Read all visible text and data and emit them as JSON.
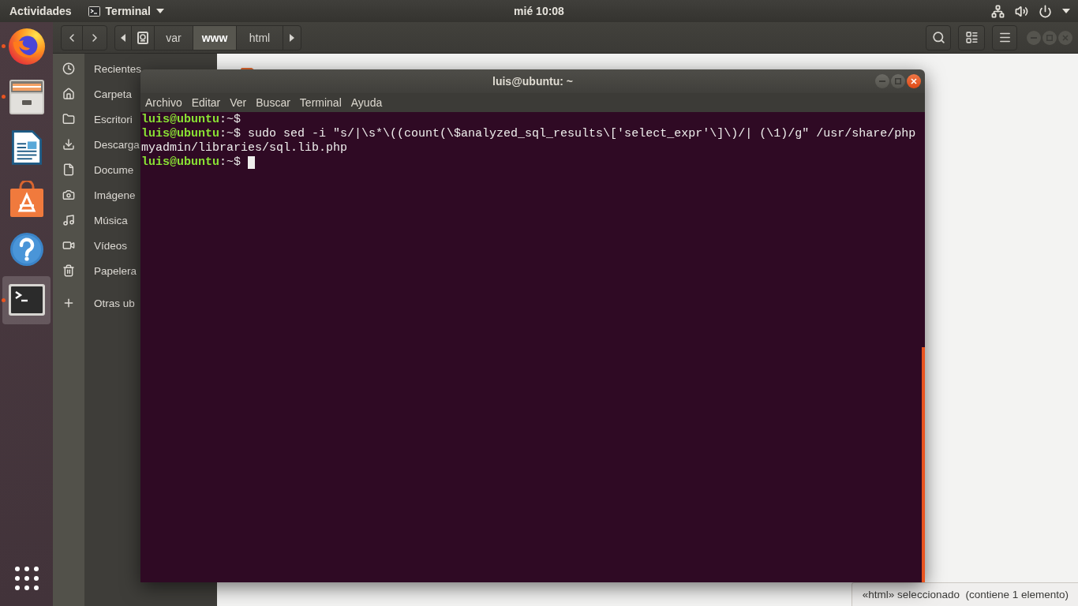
{
  "top_bar": {
    "activities": "Actividades",
    "app_menu": "Terminal",
    "clock": "mié 10:08"
  },
  "dock": {
    "items": [
      {
        "kind": "browser",
        "running": true,
        "selected": false
      },
      {
        "kind": "files",
        "running": true,
        "selected": false
      },
      {
        "kind": "writer",
        "running": false,
        "selected": false
      },
      {
        "kind": "software",
        "running": false,
        "selected": false
      },
      {
        "kind": "help",
        "running": false,
        "selected": false
      },
      {
        "kind": "terminal",
        "running": true,
        "selected": true
      }
    ]
  },
  "files_window": {
    "path_bar": [
      {
        "label": "var",
        "selected": false
      },
      {
        "label": "www",
        "selected": true
      },
      {
        "label": "html",
        "selected": false
      }
    ],
    "sidebar": {
      "items": [
        {
          "kind": "recent",
          "label": "Recientes"
        },
        {
          "kind": "home",
          "label": "Carpeta"
        },
        {
          "kind": "desktop",
          "label": "Escritori"
        },
        {
          "kind": "downloads",
          "label": "Descarga"
        },
        {
          "kind": "documents",
          "label": "Docume"
        },
        {
          "kind": "pictures",
          "label": "Imágene"
        },
        {
          "kind": "music",
          "label": "Música"
        },
        {
          "kind": "videos",
          "label": "Vídeos"
        },
        {
          "kind": "trash",
          "label": "Papelera"
        },
        {
          "kind": "other",
          "label": "Otras ub"
        }
      ]
    },
    "status": "«html» seleccionado  (contiene 1 elemento)"
  },
  "terminal": {
    "title": "luis@ubuntu: ~",
    "menu": [
      "Archivo",
      "Editar",
      "Ver",
      "Buscar",
      "Terminal",
      "Ayuda"
    ],
    "lines": [
      {
        "kind": "prompt",
        "user_host": "luis@ubuntu",
        "suffix": ":~$",
        "cursor": false
      },
      {
        "kind": "prompt",
        "user_host": "luis@ubuntu",
        "suffix": ":~$",
        "command": "sudo sed -i \"s/|\\s*\\((count(\\$analyzed_sql_results\\['select_expr'\\]\\)/| (\\1)/g\" /usr/share/php",
        "cursor": false
      },
      {
        "kind": "continuation",
        "text": "myadmin/libraries/sql.lib.php",
        "cursor": false
      },
      {
        "kind": "prompt",
        "user_host": "luis@ubuntu",
        "suffix": ":~$",
        "cursor": true
      }
    ]
  }
}
